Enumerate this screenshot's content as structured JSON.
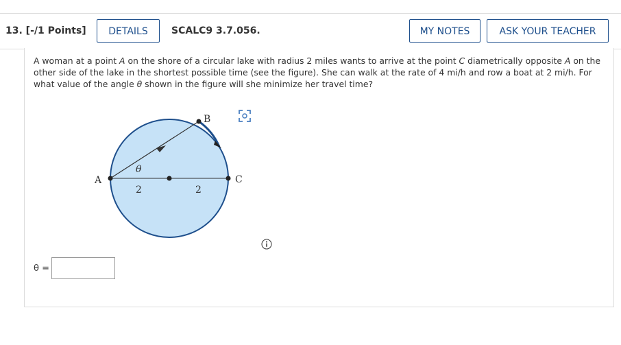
{
  "question": {
    "number_label": "13.  [-/1 Points]",
    "code": "SCALC9 3.7.056.",
    "details_label": "DETAILS",
    "my_notes_label": "MY NOTES",
    "ask_teacher_label": "ASK YOUR TEACHER"
  },
  "problem": {
    "part1": "A woman at a point ",
    "var_a": "A",
    "part2": " on the shore of a circular lake with radius 2 miles wants to arrive at the point ",
    "var_c": "C",
    "part3": " diametrically opposite ",
    "var_a2": "A",
    "part4": " on the other side of the lake in the shortest possible time (see the figure). She can walk at the rate of 4 mi/h and row a boat at 2 mi/h. For what value of the angle ",
    "var_theta": "θ",
    "part5": " shown in the figure will she minimize her travel time?"
  },
  "figure": {
    "label_a": "A",
    "label_b": "B",
    "label_c": "C",
    "label_theta": "θ",
    "label_radius_left": "2",
    "label_radius_right": "2",
    "circle_fill": "#c6e2f7",
    "circle_stroke": "#1e4f8c"
  },
  "answer": {
    "label": "θ  =",
    "value": ""
  },
  "icons": {
    "expand": "expand-figure-icon",
    "info": "info-icon"
  }
}
